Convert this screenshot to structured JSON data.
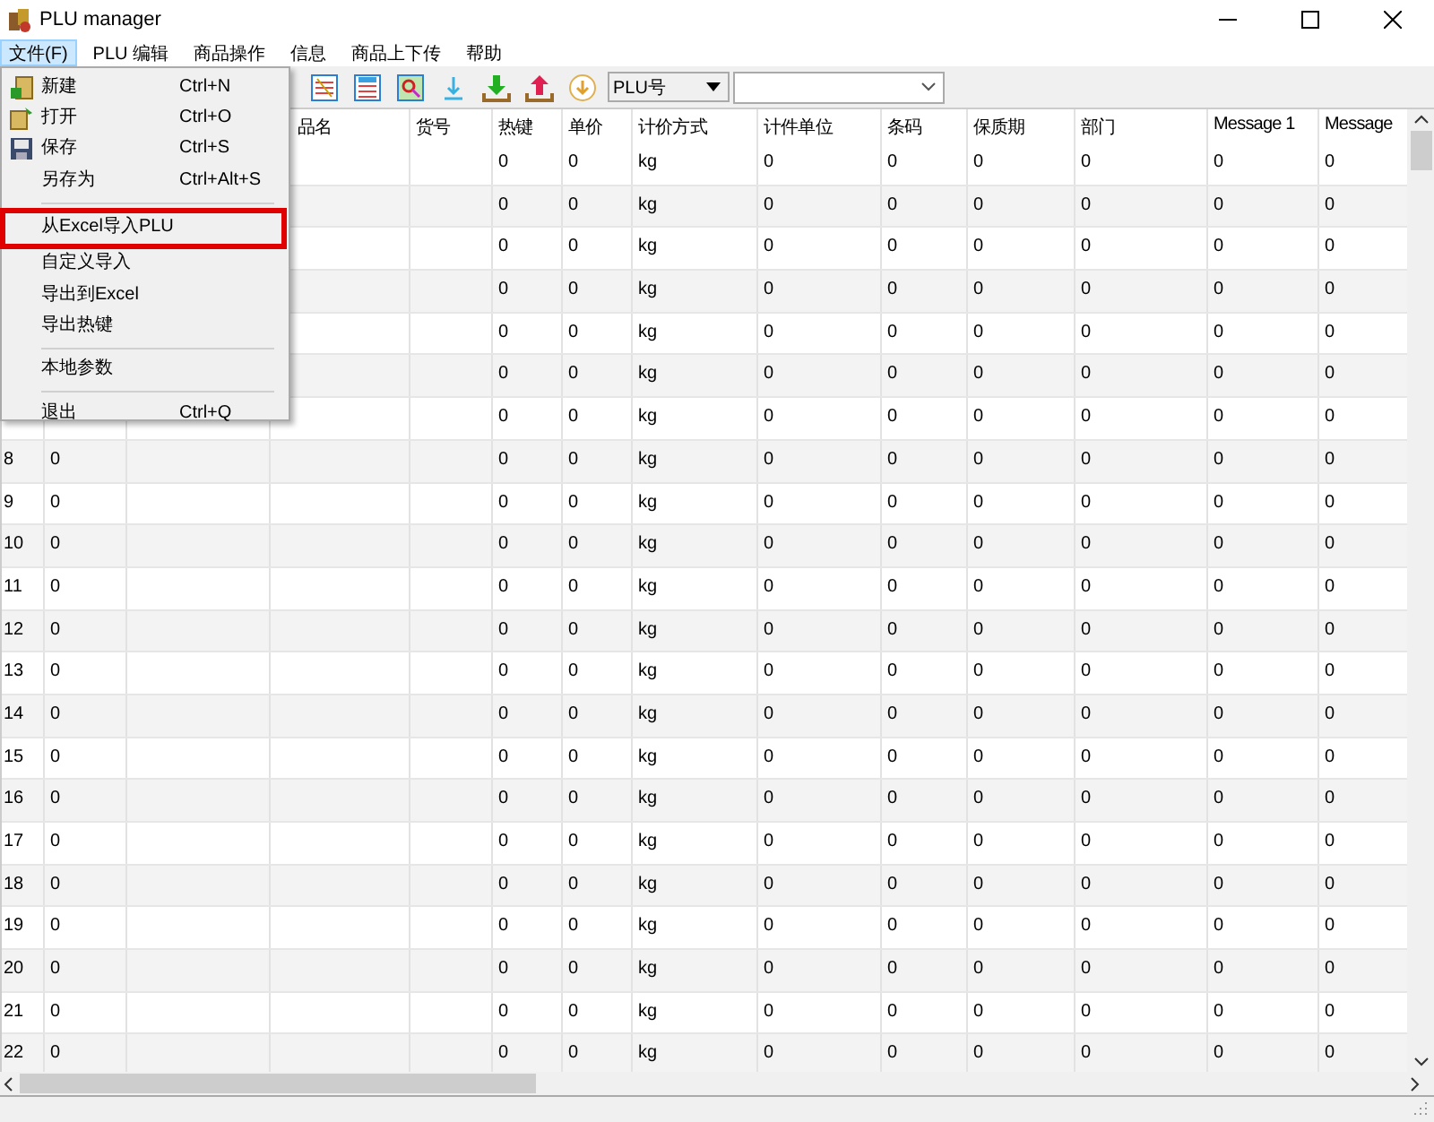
{
  "window": {
    "title": "PLU manager"
  },
  "menu_bar": [
    {
      "label": "文件(F)",
      "selected": true
    },
    {
      "label": "PLU 编辑",
      "selected": false
    },
    {
      "label": "商品操作",
      "selected": false
    },
    {
      "label": "信息",
      "selected": false
    },
    {
      "label": "商品上下传",
      "selected": false
    },
    {
      "label": "帮助",
      "selected": false
    }
  ],
  "file_menu": [
    {
      "kind": "new",
      "label": "新建",
      "shortcut": "Ctrl+N",
      "highlighted": false
    },
    {
      "kind": "open",
      "label": "打开",
      "shortcut": "Ctrl+O",
      "highlighted": false
    },
    {
      "kind": "save",
      "label": "保存",
      "shortcut": "Ctrl+S",
      "highlighted": false
    },
    {
      "kind": "plain",
      "label": "另存为",
      "shortcut": "Ctrl+Alt+S",
      "highlighted": false
    },
    {
      "kind": "separator"
    },
    {
      "kind": "plain",
      "label": "从Excel导入PLU",
      "highlighted": true
    },
    {
      "kind": "plain",
      "label": "自定义导入",
      "highlighted": false
    },
    {
      "kind": "plain",
      "label": "导出到Excel",
      "highlighted": false
    },
    {
      "kind": "plain",
      "label": "导出热键",
      "highlighted": false
    },
    {
      "kind": "separator"
    },
    {
      "kind": "plain",
      "label": "本地参数",
      "highlighted": false
    },
    {
      "kind": "separator"
    },
    {
      "kind": "plain",
      "label": "退出",
      "shortcut": "Ctrl+Q",
      "highlighted": false
    }
  ],
  "toolbar": {
    "search_field": {
      "value": "PLU号"
    }
  },
  "table": {
    "columns": [
      {},
      {},
      {},
      {
        "label": "品名"
      },
      {
        "label": "货号"
      },
      {
        "label": "热键"
      },
      {
        "label": "单价"
      },
      {
        "label": "计价方式"
      },
      {
        "label": "计件单位"
      },
      {
        "label": "条码"
      },
      {
        "label": "保质期"
      },
      {
        "label": "部门"
      },
      {
        "label": "Message 1"
      },
      {
        "label": "Message"
      }
    ],
    "rows": [
      {
        "cells": [
          "",
          "",
          "",
          "",
          "",
          "0",
          "0",
          "kg",
          "0",
          "0",
          "0",
          "0",
          "0",
          "0"
        ]
      },
      {
        "cells": [
          "",
          "",
          "",
          "",
          "",
          "0",
          "0",
          "kg",
          "0",
          "0",
          "0",
          "0",
          "0",
          "0"
        ]
      },
      {
        "cells": [
          "",
          "",
          "",
          "",
          "",
          "0",
          "0",
          "kg",
          "0",
          "0",
          "0",
          "0",
          "0",
          "0"
        ]
      },
      {
        "cells": [
          "",
          "",
          "",
          "",
          "",
          "0",
          "0",
          "kg",
          "0",
          "0",
          "0",
          "0",
          "0",
          "0"
        ]
      },
      {
        "cells": [
          "",
          "",
          "",
          "",
          "",
          "0",
          "0",
          "kg",
          "0",
          "0",
          "0",
          "0",
          "0",
          "0"
        ]
      },
      {
        "cells": [
          "",
          "",
          "",
          "",
          "",
          "0",
          "0",
          "kg",
          "0",
          "0",
          "0",
          "0",
          "0",
          "0"
        ]
      },
      {
        "cells": [
          "",
          "",
          "",
          "",
          "",
          "0",
          "0",
          "kg",
          "0",
          "0",
          "0",
          "0",
          "0",
          "0"
        ]
      },
      {
        "cells": [
          "8",
          "0",
          "",
          "",
          "",
          "0",
          "0",
          "kg",
          "0",
          "0",
          "0",
          "0",
          "0",
          "0"
        ]
      },
      {
        "cells": [
          "9",
          "0",
          "",
          "",
          "",
          "0",
          "0",
          "kg",
          "0",
          "0",
          "0",
          "0",
          "0",
          "0"
        ]
      },
      {
        "cells": [
          "10",
          "0",
          "",
          "",
          "",
          "0",
          "0",
          "kg",
          "0",
          "0",
          "0",
          "0",
          "0",
          "0"
        ]
      },
      {
        "cells": [
          "11",
          "0",
          "",
          "",
          "",
          "0",
          "0",
          "kg",
          "0",
          "0",
          "0",
          "0",
          "0",
          "0"
        ]
      },
      {
        "cells": [
          "12",
          "0",
          "",
          "",
          "",
          "0",
          "0",
          "kg",
          "0",
          "0",
          "0",
          "0",
          "0",
          "0"
        ]
      },
      {
        "cells": [
          "13",
          "0",
          "",
          "",
          "",
          "0",
          "0",
          "kg",
          "0",
          "0",
          "0",
          "0",
          "0",
          "0"
        ]
      },
      {
        "cells": [
          "14",
          "0",
          "",
          "",
          "",
          "0",
          "0",
          "kg",
          "0",
          "0",
          "0",
          "0",
          "0",
          "0"
        ]
      },
      {
        "cells": [
          "15",
          "0",
          "",
          "",
          "",
          "0",
          "0",
          "kg",
          "0",
          "0",
          "0",
          "0",
          "0",
          "0"
        ]
      },
      {
        "cells": [
          "16",
          "0",
          "",
          "",
          "",
          "0",
          "0",
          "kg",
          "0",
          "0",
          "0",
          "0",
          "0",
          "0"
        ]
      },
      {
        "cells": [
          "17",
          "0",
          "",
          "",
          "",
          "0",
          "0",
          "kg",
          "0",
          "0",
          "0",
          "0",
          "0",
          "0"
        ]
      },
      {
        "cells": [
          "18",
          "0",
          "",
          "",
          "",
          "0",
          "0",
          "kg",
          "0",
          "0",
          "0",
          "0",
          "0",
          "0"
        ]
      },
      {
        "cells": [
          "19",
          "0",
          "",
          "",
          "",
          "0",
          "0",
          "kg",
          "0",
          "0",
          "0",
          "0",
          "0",
          "0"
        ]
      },
      {
        "cells": [
          "20",
          "0",
          "",
          "",
          "",
          "0",
          "0",
          "kg",
          "0",
          "0",
          "0",
          "0",
          "0",
          "0"
        ]
      },
      {
        "cells": [
          "21",
          "0",
          "",
          "",
          "",
          "0",
          "0",
          "kg",
          "0",
          "0",
          "0",
          "0",
          "0",
          "0"
        ]
      },
      {
        "cells": [
          "22",
          "0",
          "",
          "",
          "",
          "0",
          "0",
          "kg",
          "0",
          "0",
          "0",
          "0",
          "0",
          "0"
        ]
      }
    ]
  }
}
